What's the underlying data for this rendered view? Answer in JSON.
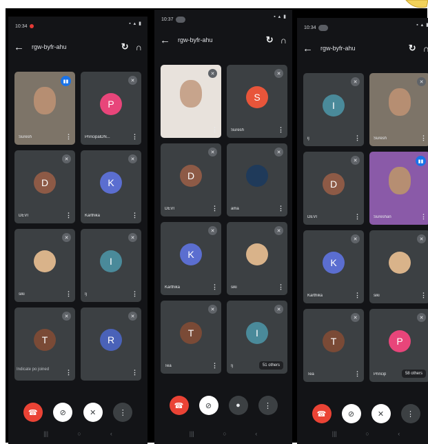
{
  "colors": {
    "end_call": "#ea4335",
    "speaking": "#1a73e8",
    "tile_bg": "#3c4043"
  },
  "phones": [
    {
      "status_time": "10:34",
      "meeting_code": "rgw-byfr-ahu",
      "tiles": [
        {
          "name": "Suresh",
          "type": "video",
          "speaking": true
        },
        {
          "initial": "P",
          "name": "PrincipalDN...",
          "color": "#e8457a"
        },
        {
          "initial": "D",
          "name": "DEVI",
          "color": "#8d5a46"
        },
        {
          "initial": "K",
          "name": "Karthika",
          "color": "#5b6ed0"
        },
        {
          "name": "siki",
          "type": "photo"
        },
        {
          "initial": "I",
          "name": "Ij",
          "color": "#4a8a9a"
        },
        {
          "initial": "T",
          "color": "#7a4a36"
        },
        {
          "initial": "R",
          "color": "#4a62b8"
        }
      ],
      "footer_text": "Indicate po joined",
      "controls": [
        "end-call",
        "camera-off",
        "mic-off",
        "more"
      ]
    },
    {
      "status_time": "10:37",
      "meeting_code": "rgw-byfr-ahu",
      "tiles": [
        {
          "type": "video"
        },
        {
          "initial": "S",
          "name": "Suresh",
          "color": "#e8553a"
        },
        {
          "initial": "D",
          "name": "DEVI",
          "color": "#8d5a46"
        },
        {
          "name": "ama",
          "type": "photo"
        },
        {
          "initial": "K",
          "name": "Karthika",
          "color": "#5b6ed0"
        },
        {
          "name": "siki",
          "type": "photo"
        },
        {
          "initial": "T",
          "name": "Tea",
          "color": "#7a4a36"
        },
        {
          "initial": "I",
          "name": "Ij",
          "color": "#4a8a9a",
          "others": "51 others"
        }
      ],
      "controls": [
        "end-call",
        "camera-off",
        "mic",
        "more"
      ]
    },
    {
      "status_time": "10:34",
      "meeting_code": "rgw-byfr-ahu",
      "tiles": [
        {
          "initial": "I",
          "name": "ij",
          "color": "#4a8a9a"
        },
        {
          "name": "Suresh",
          "type": "video"
        },
        {
          "initial": "D",
          "name": "DEVI",
          "color": "#8d5a46"
        },
        {
          "name": "Sureshan",
          "type": "video",
          "speaking": true
        },
        {
          "initial": "K",
          "name": "Karthika",
          "color": "#5b6ed0"
        },
        {
          "name": "siki",
          "type": "photo"
        },
        {
          "initial": "T",
          "name": "Tea",
          "color": "#7a4a36"
        },
        {
          "initial": "P",
          "name": "Princip",
          "color": "#e8457a",
          "others": "58 others"
        }
      ],
      "controls": [
        "end-call",
        "camera-off",
        "mic-off",
        "more"
      ]
    }
  ]
}
